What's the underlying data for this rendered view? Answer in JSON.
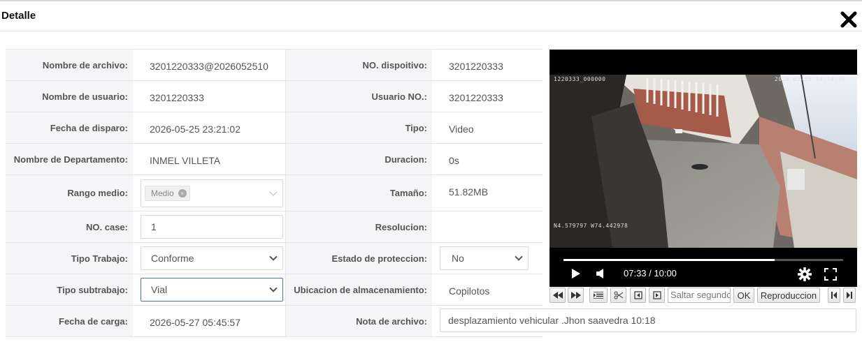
{
  "dialog": {
    "title": "Detalle"
  },
  "fields": {
    "nombre_archivo": {
      "label": "Nombre de archivo:",
      "value": "3201220333@2026052510"
    },
    "no_dispositivo": {
      "label": "NO. dispoitivo:",
      "value": "3201220333"
    },
    "nombre_usuario": {
      "label": "Nombre de usuario:",
      "value": "3201220333"
    },
    "usuario_no": {
      "label": "Usuario NO.:",
      "value": "3201220333"
    },
    "fecha_disparo": {
      "label": "Fecha de disparo:",
      "value": "2026-05-25 23:21:02"
    },
    "tipo": {
      "label": "Tipo:",
      "value": "Video"
    },
    "departamento": {
      "label": "Nombre de Departamento:",
      "value": "INMEL VILLETA"
    },
    "duracion": {
      "label": "Duracion:",
      "value": "0s"
    },
    "rango_medio": {
      "label": "Rango medio:",
      "tag": "Medio"
    },
    "tamano": {
      "label": "Tamaño:",
      "value": "51.82MB"
    },
    "no_case": {
      "label": "NO. case:",
      "value": "1"
    },
    "resolucion": {
      "label": "Resolucion:",
      "value": ""
    },
    "tipo_trabajo": {
      "label": "Tipo Trabajo:",
      "value": "Conforme"
    },
    "estado_proteccion": {
      "label": "Estado de proteccion:",
      "value": "No"
    },
    "tipo_subtrabajo": {
      "label": "Tipo subtrabajo:",
      "value": "Vial"
    },
    "ubicacion": {
      "label": "Ubicacion de almacenamiento:",
      "value": "Copilotos"
    },
    "fecha_carga": {
      "label": "Fecha de carga:",
      "value": "2026-05-27 05:45:57"
    },
    "nota_archivo": {
      "label": "Nota de archivo:",
      "value": "desplazamiento vehicular .Jhon saavedra 10:18"
    }
  },
  "player": {
    "osd_id": "1220333_000000",
    "osd_datetime": "2026-05-25  10:18:36",
    "osd_coords": "N4.579797  W74.442978",
    "time": "07:33 / 10:00",
    "progress": 0.755
  },
  "toolbar": {
    "seek_placeholder": "Saltar segundos",
    "ok_label": "OK",
    "playback_label": "Reproduccion"
  },
  "colors": {
    "label_bg": "#f5f5f7",
    "border": "#e6e6e6",
    "focus_border": "#4a76a8"
  }
}
